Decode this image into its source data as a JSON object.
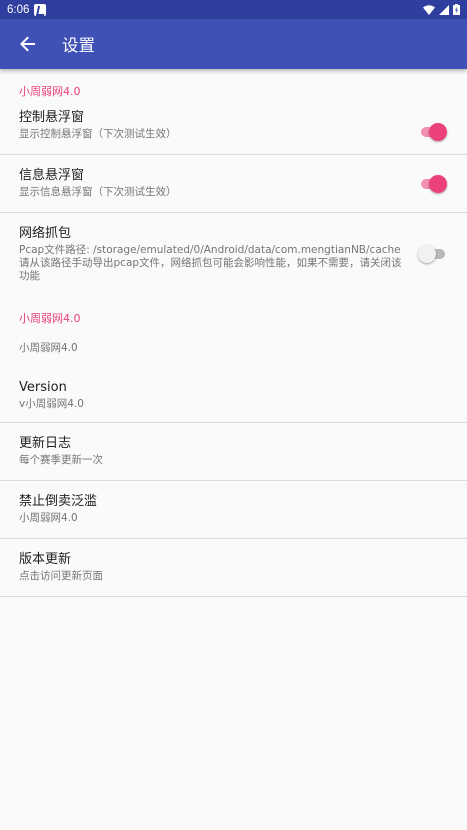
{
  "status_bar": {
    "time": "6:06",
    "icons": [
      "notification-icon",
      "wifi-icon",
      "signal-icon",
      "battery-icon"
    ]
  },
  "app_bar": {
    "title": "设置",
    "back_icon": "arrow-back-icon"
  },
  "colors": {
    "primary": "#3f51b5",
    "primary_dark": "#303f9f",
    "accent": "#ec407a",
    "background": "#fafafa"
  },
  "sections": [
    {
      "category": "小周弱网4.0",
      "items": [
        {
          "title": "控制悬浮窗",
          "summary": "显示控制悬浮窗（下次测试生效）",
          "switch_on": true
        },
        {
          "title": "信息悬浮窗",
          "summary": "显示信息悬浮窗（下次测试生效）",
          "switch_on": true
        },
        {
          "title": "网络抓包",
          "summary": "Pcap文件路径: /storage/emulated/0/Android/data/com.mengtianNB/cache 请从该路径手动导出pcap文件，网络抓包可能会影响性能，如果不需要，请关闭该功能",
          "switch_on": false
        }
      ]
    },
    {
      "category": "小周弱网4.0",
      "items": [
        {
          "summary": "小周弱网4.0"
        },
        {
          "title": "Version",
          "summary": "v小周弱网4.0"
        },
        {
          "title": "更新日志",
          "summary": "每个赛季更新一次"
        },
        {
          "title": "禁止倒卖泛滥",
          "summary": "小周弱网4.0"
        },
        {
          "title": "版本更新",
          "summary": "点击访问更新页面"
        }
      ]
    }
  ]
}
